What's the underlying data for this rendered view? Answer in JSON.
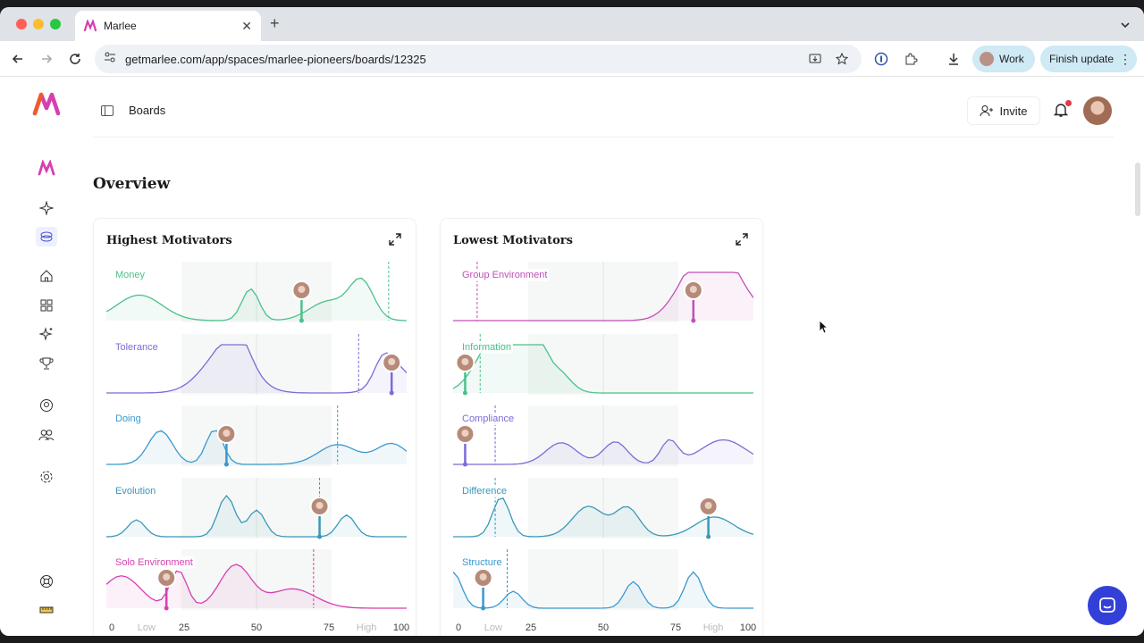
{
  "browser": {
    "tab_title": "Marlee",
    "url": "getmarlee.com/app/spaces/marlee-pioneers/boards/12325",
    "profile_label": "Work",
    "update_label": "Finish update"
  },
  "header": {
    "breadcrumb": "Boards",
    "invite_label": "Invite"
  },
  "page": {
    "title": "Overview"
  },
  "cards": [
    {
      "title": "Highest Motivators",
      "rows": [
        {
          "label": "Money",
          "color": "#4cc08a",
          "marker": 65,
          "dashed": 94
        },
        {
          "label": "Tolerance",
          "color": "#7c6bd6",
          "marker": 95,
          "dashed": 84
        },
        {
          "label": "Doing",
          "color": "#3a98d0",
          "marker": 40,
          "dashed": 77
        },
        {
          "label": "Evolution",
          "color": "#3a98b8",
          "marker": 71,
          "dashed": 71
        },
        {
          "label": "Solo Environment",
          "color": "#d63fb1",
          "marker": 20,
          "dashed": 69
        }
      ]
    },
    {
      "title": "Lowest Motivators",
      "rows": [
        {
          "label": "Group Environment",
          "color": "#c04fb8",
          "marker": 80,
          "dashed": 8
        },
        {
          "label": "Information",
          "color": "#4cc08a",
          "marker": 4,
          "dashed": 9
        },
        {
          "label": "Compliance",
          "color": "#7c6bd6",
          "marker": 4,
          "dashed": 14
        },
        {
          "label": "Difference",
          "color": "#3a98b8",
          "marker": 85,
          "dashed": 14
        },
        {
          "label": "Structure",
          "color": "#3a98d0",
          "marker": 10,
          "dashed": 18
        }
      ]
    }
  ],
  "axis": {
    "ticks": [
      "0",
      "Low",
      "25",
      "50",
      "75",
      "High",
      "100"
    ]
  }
}
